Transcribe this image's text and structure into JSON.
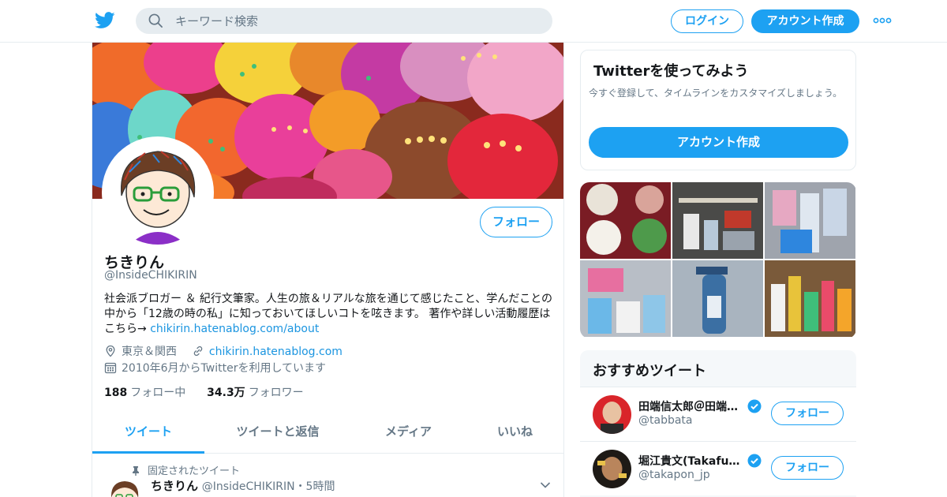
{
  "header": {
    "search_placeholder": "キーワード検索",
    "login_label": "ログイン",
    "signup_label": "アカウント作成"
  },
  "profile": {
    "name": "ちきりん",
    "handle": "@InsideCHIKIRIN",
    "follow_label": "フォロー",
    "bio_text": "社会派ブロガー ＆ 紀行文筆家。人生の旅＆リアルな旅を通じて感じたこと、学んだことの中から「12歳の時の私」に知っておいてほしいコトを呟きます。 著作や詳しい活動履歴はこちら→ ",
    "bio_link": "chikirin.hatenablog.com/about",
    "location": "東京＆関西",
    "website": "chikirin.hatenablog.com",
    "joined": "2010年6月からTwitterを利用しています",
    "following_count": "188",
    "following_label": "フォロー中",
    "followers_count": "34.3万",
    "followers_label": "フォロワー"
  },
  "tabs": [
    {
      "label": "ツイート",
      "active": true
    },
    {
      "label": "ツイートと返信",
      "active": false
    },
    {
      "label": "メディア",
      "active": false
    },
    {
      "label": "いいね",
      "active": false
    }
  ],
  "pinned_tweet": {
    "pinned_label": "固定されたツイート",
    "author_name": "ちきりん",
    "author_handle": "@InsideCHIKIRIN",
    "time": "・5時間"
  },
  "signup_card": {
    "title": "Twitterを使ってみよう",
    "description": "今すぐ登録して、タイムラインをカスタマイズしましょう。",
    "button_label": "アカウント作成"
  },
  "recommended": {
    "title": "おすすめツイート",
    "items": [
      {
        "name": "田端信太郎＠田端大学...",
        "handle": "@tabbata",
        "follow_label": "フォロー"
      },
      {
        "name": "堀江貴文(Takafumi H...",
        "handle": "@takapon_jp",
        "follow_label": "フォロー"
      }
    ]
  },
  "colors": {
    "accent": "#1da1f2",
    "link": "#1b95e0",
    "muted_text": "#657786",
    "border": "#e6ecf0"
  }
}
